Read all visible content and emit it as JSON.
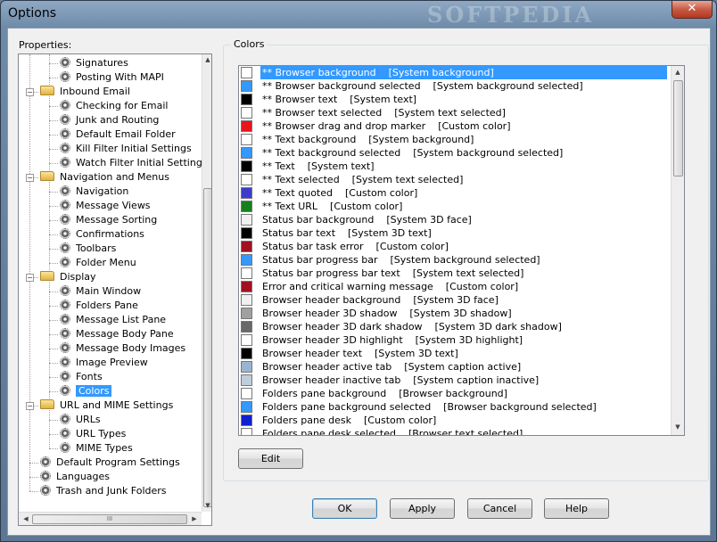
{
  "window": {
    "title": "Options",
    "watermark": "SOFTPEDIA",
    "close_glyph": "✕"
  },
  "properties_label": "Properties:",
  "colors_group_label": "Colors",
  "tree": [
    {
      "label": "Signatures",
      "icon": "gear-icon",
      "level": 2
    },
    {
      "label": "Posting With MAPI",
      "icon": "gear-icon",
      "level": 2
    },
    {
      "label": "Inbound Email",
      "icon": "folder-icon",
      "level": 1,
      "expanded": true
    },
    {
      "label": "Checking for Email",
      "icon": "gear-icon",
      "level": 2
    },
    {
      "label": "Junk and Routing",
      "icon": "gear-icon",
      "level": 2
    },
    {
      "label": "Default Email Folder",
      "icon": "gear-icon",
      "level": 2
    },
    {
      "label": "Kill Filter Initial Settings",
      "icon": "gear-icon",
      "level": 2
    },
    {
      "label": "Watch Filter Initial Settings",
      "icon": "gear-icon",
      "level": 2
    },
    {
      "label": "Navigation and Menus",
      "icon": "folder-icon",
      "level": 1,
      "expanded": true
    },
    {
      "label": "Navigation",
      "icon": "gear-icon",
      "level": 2
    },
    {
      "label": "Message Views",
      "icon": "gear-icon",
      "level": 2
    },
    {
      "label": "Message Sorting",
      "icon": "gear-icon",
      "level": 2
    },
    {
      "label": "Confirmations",
      "icon": "gear-icon",
      "level": 2
    },
    {
      "label": "Toolbars",
      "icon": "gear-icon",
      "level": 2
    },
    {
      "label": "Folder Menu",
      "icon": "gear-icon",
      "level": 2
    },
    {
      "label": "Display",
      "icon": "folder-icon",
      "level": 1,
      "expanded": true
    },
    {
      "label": "Main Window",
      "icon": "gear-icon",
      "level": 2
    },
    {
      "label": "Folders Pane",
      "icon": "gear-icon",
      "level": 2
    },
    {
      "label": "Message List Pane",
      "icon": "gear-icon",
      "level": 2
    },
    {
      "label": "Message Body Pane",
      "icon": "gear-icon",
      "level": 2
    },
    {
      "label": "Message Body Images",
      "icon": "gear-icon",
      "level": 2
    },
    {
      "label": "Image Preview",
      "icon": "gear-icon",
      "level": 2
    },
    {
      "label": "Fonts",
      "icon": "gear-icon",
      "level": 2
    },
    {
      "label": "Colors",
      "icon": "gear-icon",
      "level": 2,
      "selected": true
    },
    {
      "label": "URL and MIME Settings",
      "icon": "folder-icon",
      "level": 1,
      "expanded": true
    },
    {
      "label": "URLs",
      "icon": "gear-icon",
      "level": 2
    },
    {
      "label": "URL Types",
      "icon": "gear-icon",
      "level": 2
    },
    {
      "label": "MIME Types",
      "icon": "gear-icon",
      "level": 2
    },
    {
      "label": "Default Program Settings",
      "icon": "gear-icon",
      "level": 1
    },
    {
      "label": "Languages",
      "icon": "gear-icon",
      "level": 1
    },
    {
      "label": "Trash and Junk Folders",
      "icon": "gear-icon",
      "level": 1
    }
  ],
  "colors": [
    {
      "label": "** Browser background    [System background]",
      "color": "#ffffff",
      "selected": true
    },
    {
      "label": "** Browser background selected    [System background selected]",
      "color": "#3399ff"
    },
    {
      "label": "** Browser text    [System text]",
      "color": "#000000"
    },
    {
      "label": "** Browser text selected    [System text selected]",
      "color": "#ffffff"
    },
    {
      "label": "** Browser drag and drop marker    [Custom color]",
      "color": "#e8141c"
    },
    {
      "label": "** Text background    [System background]",
      "color": "#ffffff"
    },
    {
      "label": "** Text background selected    [System background selected]",
      "color": "#3399ff"
    },
    {
      "label": "** Text    [System text]",
      "color": "#000000"
    },
    {
      "label": "** Text selected    [System text selected]",
      "color": "#ffffff"
    },
    {
      "label": "** Text quoted    [Custom color]",
      "color": "#3c3ccc"
    },
    {
      "label": "** Text URL    [Custom color]",
      "color": "#15801c"
    },
    {
      "label": "Status bar background    [System 3D face]",
      "color": "#f0f0f0"
    },
    {
      "label": "Status bar text    [System 3D text]",
      "color": "#000000"
    },
    {
      "label": "Status bar task error    [Custom color]",
      "color": "#a01020"
    },
    {
      "label": "Status bar progress bar    [System background selected]",
      "color": "#3399ff"
    },
    {
      "label": "Status bar progress bar text    [System text selected]",
      "color": "#ffffff"
    },
    {
      "label": "Error and critical warning message    [Custom color]",
      "color": "#a01020"
    },
    {
      "label": "Browser header background    [System 3D face]",
      "color": "#f0f0f0"
    },
    {
      "label": "Browser header 3D shadow    [System 3D shadow]",
      "color": "#a0a0a0"
    },
    {
      "label": "Browser header 3D dark shadow    [System 3D dark shadow]",
      "color": "#696969"
    },
    {
      "label": "Browser header 3D highlight    [System 3D highlight]",
      "color": "#ffffff"
    },
    {
      "label": "Browser header text    [System 3D text]",
      "color": "#000000"
    },
    {
      "label": "Browser header active tab    [System caption active]",
      "color": "#99b4d1"
    },
    {
      "label": "Browser header inactive tab    [System caption inactive]",
      "color": "#bfcddb"
    },
    {
      "label": "Folders pane background    [Browser background]",
      "color": "#ffffff"
    },
    {
      "label": "Folders pane background selected    [Browser background selected]",
      "color": "#3399ff"
    },
    {
      "label": "Folders pane desk    [Custom color]",
      "color": "#1020d0"
    },
    {
      "label": "Folders pane desk selected    [Browser text selected]",
      "color": "#ffffff"
    }
  ],
  "buttons": {
    "edit": "Edit",
    "ok": "OK",
    "apply": "Apply",
    "cancel": "Cancel",
    "help": "Help"
  },
  "scroll_glyphs": {
    "up": "▲",
    "down": "▼",
    "left": "◀",
    "right": "▶",
    "grip": "III"
  }
}
